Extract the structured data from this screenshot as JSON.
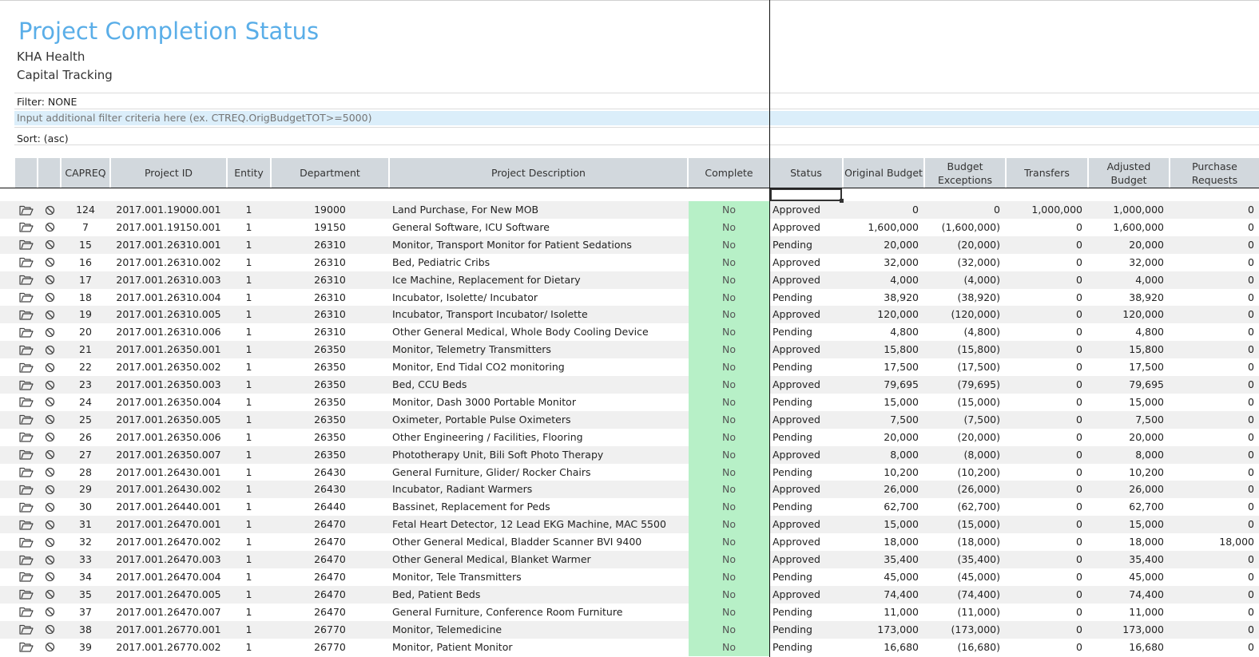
{
  "report": {
    "title": "Project Completion Status",
    "subtitle1": "KHA Health",
    "subtitle2": "Capital Tracking",
    "filter": "Filter: NONE",
    "filter_placeholder": "Input additional filter criteria here (ex. CTREQ.OrigBudgetTOT>=5000)",
    "sort": "Sort:  (asc)"
  },
  "icons": {
    "open": "folder-open-icon",
    "disable": "prohibited-icon"
  },
  "colors": {
    "title": "#5aaee8",
    "header_bg": "#d2d8dd",
    "complete_bg": "#b7f0c7",
    "filter_bg": "#dbeefa"
  },
  "columns": {
    "capreq": "CAPREQ",
    "project_id": "Project ID",
    "entity": "Entity",
    "department": "Department",
    "description": "Project Description",
    "complete": "Complete",
    "status": "Status",
    "orig_budget": "Original Budget",
    "budget_exceptions": "Budget Exceptions",
    "transfers": "Transfers",
    "adjusted_budget": "Adjusted Budget",
    "purchase_requests": "Purchase Requests"
  },
  "rows": [
    {
      "capreq": "124",
      "project_id": "2017.001.19000.001",
      "entity": "1",
      "department": "19000",
      "description": "Land Purchase, For New MOB",
      "complete": "No",
      "status": "Approved",
      "orig_budget": "0",
      "budget_exceptions": "0",
      "transfers": "1,000,000",
      "adjusted_budget": "1,000,000",
      "purchase_requests": "0"
    },
    {
      "capreq": "7",
      "project_id": "2017.001.19150.001",
      "entity": "1",
      "department": "19150",
      "description": "General Software, ICU Software",
      "complete": "No",
      "status": "Approved",
      "orig_budget": "1,600,000",
      "budget_exceptions": "(1,600,000)",
      "transfers": "0",
      "adjusted_budget": "1,600,000",
      "purchase_requests": "0"
    },
    {
      "capreq": "15",
      "project_id": "2017.001.26310.001",
      "entity": "1",
      "department": "26310",
      "description": "Monitor, Transport Monitor for Patient Sedations",
      "complete": "No",
      "status": "Pending",
      "orig_budget": "20,000",
      "budget_exceptions": "(20,000)",
      "transfers": "0",
      "adjusted_budget": "20,000",
      "purchase_requests": "0"
    },
    {
      "capreq": "16",
      "project_id": "2017.001.26310.002",
      "entity": "1",
      "department": "26310",
      "description": "Bed, Pediatric Cribs",
      "complete": "No",
      "status": "Approved",
      "orig_budget": "32,000",
      "budget_exceptions": "(32,000)",
      "transfers": "0",
      "adjusted_budget": "32,000",
      "purchase_requests": "0"
    },
    {
      "capreq": "17",
      "project_id": "2017.001.26310.003",
      "entity": "1",
      "department": "26310",
      "description": "Ice Machine, Replacement for Dietary",
      "complete": "No",
      "status": "Approved",
      "orig_budget": "4,000",
      "budget_exceptions": "(4,000)",
      "transfers": "0",
      "adjusted_budget": "4,000",
      "purchase_requests": "0"
    },
    {
      "capreq": "18",
      "project_id": "2017.001.26310.004",
      "entity": "1",
      "department": "26310",
      "description": "Incubator, Isolette/ Incubator",
      "complete": "No",
      "status": "Pending",
      "orig_budget": "38,920",
      "budget_exceptions": "(38,920)",
      "transfers": "0",
      "adjusted_budget": "38,920",
      "purchase_requests": "0"
    },
    {
      "capreq": "19",
      "project_id": "2017.001.26310.005",
      "entity": "1",
      "department": "26310",
      "description": "Incubator, Transport Incubator/ Isolette",
      "complete": "No",
      "status": "Approved",
      "orig_budget": "120,000",
      "budget_exceptions": "(120,000)",
      "transfers": "0",
      "adjusted_budget": "120,000",
      "purchase_requests": "0"
    },
    {
      "capreq": "20",
      "project_id": "2017.001.26310.006",
      "entity": "1",
      "department": "26310",
      "description": "Other General Medical, Whole Body Cooling Device",
      "complete": "No",
      "status": "Pending",
      "orig_budget": "4,800",
      "budget_exceptions": "(4,800)",
      "transfers": "0",
      "adjusted_budget": "4,800",
      "purchase_requests": "0"
    },
    {
      "capreq": "21",
      "project_id": "2017.001.26350.001",
      "entity": "1",
      "department": "26350",
      "description": "Monitor, Telemetry Transmitters",
      "complete": "No",
      "status": "Approved",
      "orig_budget": "15,800",
      "budget_exceptions": "(15,800)",
      "transfers": "0",
      "adjusted_budget": "15,800",
      "purchase_requests": "0"
    },
    {
      "capreq": "22",
      "project_id": "2017.001.26350.002",
      "entity": "1",
      "department": "26350",
      "description": "Monitor, End Tidal CO2 monitoring",
      "complete": "No",
      "status": "Pending",
      "orig_budget": "17,500",
      "budget_exceptions": "(17,500)",
      "transfers": "0",
      "adjusted_budget": "17,500",
      "purchase_requests": "0"
    },
    {
      "capreq": "23",
      "project_id": "2017.001.26350.003",
      "entity": "1",
      "department": "26350",
      "description": "Bed, CCU Beds",
      "complete": "No",
      "status": "Approved",
      "orig_budget": "79,695",
      "budget_exceptions": "(79,695)",
      "transfers": "0",
      "adjusted_budget": "79,695",
      "purchase_requests": "0"
    },
    {
      "capreq": "24",
      "project_id": "2017.001.26350.004",
      "entity": "1",
      "department": "26350",
      "description": "Monitor, Dash 3000 Portable Monitor",
      "complete": "No",
      "status": "Pending",
      "orig_budget": "15,000",
      "budget_exceptions": "(15,000)",
      "transfers": "0",
      "adjusted_budget": "15,000",
      "purchase_requests": "0"
    },
    {
      "capreq": "25",
      "project_id": "2017.001.26350.005",
      "entity": "1",
      "department": "26350",
      "description": "Oximeter, Portable Pulse Oximeters",
      "complete": "No",
      "status": "Approved",
      "orig_budget": "7,500",
      "budget_exceptions": "(7,500)",
      "transfers": "0",
      "adjusted_budget": "7,500",
      "purchase_requests": "0"
    },
    {
      "capreq": "26",
      "project_id": "2017.001.26350.006",
      "entity": "1",
      "department": "26350",
      "description": "Other Engineering / Facilities, Flooring",
      "complete": "No",
      "status": "Pending",
      "orig_budget": "20,000",
      "budget_exceptions": "(20,000)",
      "transfers": "0",
      "adjusted_budget": "20,000",
      "purchase_requests": "0"
    },
    {
      "capreq": "27",
      "project_id": "2017.001.26350.007",
      "entity": "1",
      "department": "26350",
      "description": "Phototherapy Unit, Bili Soft Photo Therapy",
      "complete": "No",
      "status": "Approved",
      "orig_budget": "8,000",
      "budget_exceptions": "(8,000)",
      "transfers": "0",
      "adjusted_budget": "8,000",
      "purchase_requests": "0"
    },
    {
      "capreq": "28",
      "project_id": "2017.001.26430.001",
      "entity": "1",
      "department": "26430",
      "description": "General Furniture, Glider/ Rocker Chairs",
      "complete": "No",
      "status": "Pending",
      "orig_budget": "10,200",
      "budget_exceptions": "(10,200)",
      "transfers": "0",
      "adjusted_budget": "10,200",
      "purchase_requests": "0"
    },
    {
      "capreq": "29",
      "project_id": "2017.001.26430.002",
      "entity": "1",
      "department": "26430",
      "description": "Incubator, Radiant Warmers",
      "complete": "No",
      "status": "Approved",
      "orig_budget": "26,000",
      "budget_exceptions": "(26,000)",
      "transfers": "0",
      "adjusted_budget": "26,000",
      "purchase_requests": "0"
    },
    {
      "capreq": "30",
      "project_id": "2017.001.26440.001",
      "entity": "1",
      "department": "26440",
      "description": "Bassinet, Replacement for Peds",
      "complete": "No",
      "status": "Pending",
      "orig_budget": "62,700",
      "budget_exceptions": "(62,700)",
      "transfers": "0",
      "adjusted_budget": "62,700",
      "purchase_requests": "0"
    },
    {
      "capreq": "31",
      "project_id": "2017.001.26470.001",
      "entity": "1",
      "department": "26470",
      "description": "Fetal Heart Detector, 12 Lead EKG Machine, MAC 5500",
      "complete": "No",
      "status": "Approved",
      "orig_budget": "15,000",
      "budget_exceptions": "(15,000)",
      "transfers": "0",
      "adjusted_budget": "15,000",
      "purchase_requests": "0"
    },
    {
      "capreq": "32",
      "project_id": "2017.001.26470.002",
      "entity": "1",
      "department": "26470",
      "description": "Other General Medical, Bladder Scanner BVI 9400",
      "complete": "No",
      "status": "Approved",
      "orig_budget": "18,000",
      "budget_exceptions": "(18,000)",
      "transfers": "0",
      "adjusted_budget": "18,000",
      "purchase_requests": "18,000"
    },
    {
      "capreq": "33",
      "project_id": "2017.001.26470.003",
      "entity": "1",
      "department": "26470",
      "description": "Other General Medical, Blanket Warmer",
      "complete": "No",
      "status": "Approved",
      "orig_budget": "35,400",
      "budget_exceptions": "(35,400)",
      "transfers": "0",
      "adjusted_budget": "35,400",
      "purchase_requests": "0"
    },
    {
      "capreq": "34",
      "project_id": "2017.001.26470.004",
      "entity": "1",
      "department": "26470",
      "description": "Monitor, Tele Transmitters",
      "complete": "No",
      "status": "Pending",
      "orig_budget": "45,000",
      "budget_exceptions": "(45,000)",
      "transfers": "0",
      "adjusted_budget": "45,000",
      "purchase_requests": "0"
    },
    {
      "capreq": "35",
      "project_id": "2017.001.26470.005",
      "entity": "1",
      "department": "26470",
      "description": "Bed, Patient Beds",
      "complete": "No",
      "status": "Approved",
      "orig_budget": "74,400",
      "budget_exceptions": "(74,400)",
      "transfers": "0",
      "adjusted_budget": "74,400",
      "purchase_requests": "0"
    },
    {
      "capreq": "37",
      "project_id": "2017.001.26470.007",
      "entity": "1",
      "department": "26470",
      "description": "General Furniture, Conference Room Furniture",
      "complete": "No",
      "status": "Pending",
      "orig_budget": "11,000",
      "budget_exceptions": "(11,000)",
      "transfers": "0",
      "adjusted_budget": "11,000",
      "purchase_requests": "0"
    },
    {
      "capreq": "38",
      "project_id": "2017.001.26770.001",
      "entity": "1",
      "department": "26770",
      "description": "Monitor, Telemedicine",
      "complete": "No",
      "status": "Pending",
      "orig_budget": "173,000",
      "budget_exceptions": "(173,000)",
      "transfers": "0",
      "adjusted_budget": "173,000",
      "purchase_requests": "0"
    },
    {
      "capreq": "39",
      "project_id": "2017.001.26770.002",
      "entity": "1",
      "department": "26770",
      "description": "Monitor, Patient Monitor",
      "complete": "No",
      "status": "Pending",
      "orig_budget": "16,680",
      "budget_exceptions": "(16,680)",
      "transfers": "0",
      "adjusted_budget": "16,680",
      "purchase_requests": "0"
    }
  ]
}
